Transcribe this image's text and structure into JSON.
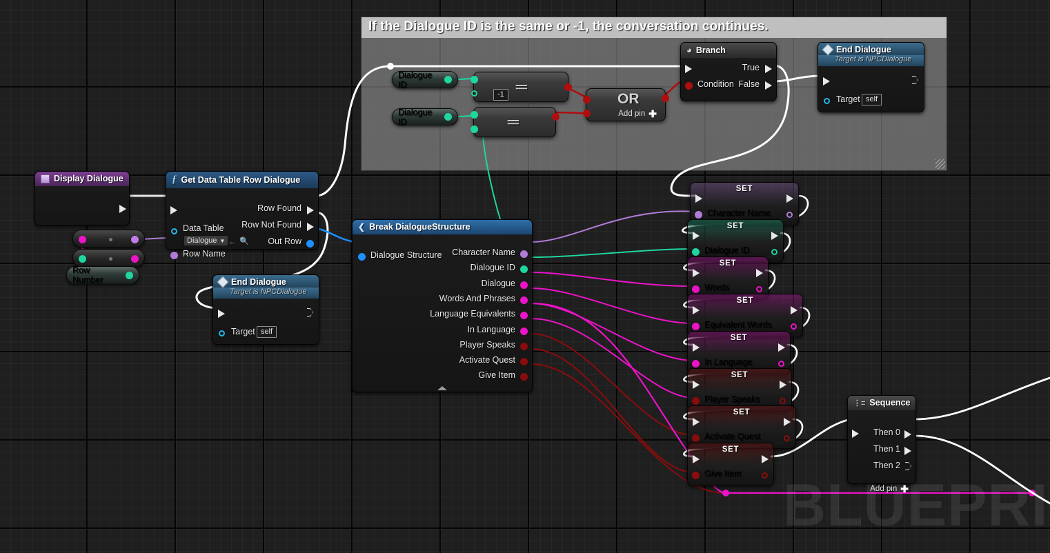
{
  "comment": {
    "text": "If the Dialogue ID is the same or -1, the conversation continues."
  },
  "watermark": {
    "text": "BLUEPRINT"
  },
  "colors": {
    "exec_white": "#e8e8e8",
    "struct_blue": "#1e90ff",
    "name_purple": "#c07ce8",
    "int_green": "#1fd6a0",
    "string_magenta": "#ec13c8",
    "bool_red": "#a10a0a",
    "object_cyan": "#25b6e8",
    "text_purple": "#b07cd8"
  },
  "nodes": {
    "display_dialogue": {
      "title": "Display Dialogue",
      "icon": "event-icon"
    },
    "get_data_table_row": {
      "title": "Get Data Table Row Dialogue",
      "icon": "function-icon",
      "in_exec": "",
      "inputs": [
        {
          "label": "Data Table",
          "value": "Dialogue"
        },
        {
          "label": "Row Name",
          "value": ""
        }
      ],
      "outputs": [
        {
          "label": "Row Found"
        },
        {
          "label": "Row Not Found"
        },
        {
          "label": "Out Row"
        }
      ]
    },
    "end_dialogue_left": {
      "title": "End Dialogue",
      "subtitle": "Target is NPCDialogue",
      "icon": "diamond-icon",
      "target_label": "Target",
      "target_value": "self"
    },
    "end_dialogue_right": {
      "title": "End Dialogue",
      "subtitle": "Target is NPCDialogue",
      "icon": "diamond-icon",
      "target_label": "Target",
      "target_value": "self"
    },
    "row_number": {
      "label": "Row Number"
    },
    "dialogue_id_get_1": {
      "label": "Dialogue ID"
    },
    "dialogue_id_get_2": {
      "label": "Dialogue ID"
    },
    "equals_1": {
      "symbol": "==",
      "literal": "-1"
    },
    "equals_2": {
      "symbol": "==",
      "literal": ""
    },
    "or_node": {
      "symbol": "OR",
      "add_pin": "Add pin"
    },
    "branch": {
      "title": "Branch",
      "icon": "branch-icon",
      "condition_label": "Condition",
      "true_label": "True",
      "false_label": "False"
    },
    "break_struct": {
      "title": "Break DialogueStructure",
      "icon": "break-icon",
      "input": "Dialogue Structure",
      "outputs": [
        {
          "label": "Character Name",
          "color": "#b07cd8"
        },
        {
          "label": "Dialogue ID",
          "color": "#1fd6a0"
        },
        {
          "label": "Dialogue",
          "color": "#ec13c8"
        },
        {
          "label": "Words And Phrases",
          "color": "#ec13c8"
        },
        {
          "label": "Language Equivalents",
          "color": "#ec13c8"
        },
        {
          "label": "In Language",
          "color": "#ec13c8"
        },
        {
          "label": "Player Speaks",
          "color": "#8b0c0c"
        },
        {
          "label": "Activate Quest",
          "color": "#8b0c0c"
        },
        {
          "label": "Give Item",
          "color": "#8b0c0c"
        }
      ]
    },
    "sequence": {
      "title": "Sequence",
      "icon": "sequence-icon",
      "outputs": [
        "Then 0",
        "Then 1",
        "Then 2"
      ],
      "add_pin": "Add pin"
    }
  },
  "set_nodes": [
    {
      "title": "SET",
      "label": "Character Name",
      "color": "#b07cd8",
      "tint": "rgba(176,124,216,0.30)"
    },
    {
      "title": "SET",
      "label": "Dialogue ID",
      "color": "#1fd6a0",
      "tint": "rgba(31,214,160,0.28)"
    },
    {
      "title": "SET",
      "label": "Words",
      "color": "#ec13c8",
      "tint": "rgba(236,19,200,0.30)"
    },
    {
      "title": "SET",
      "label": "Equivalent Words",
      "color": "#ec13c8",
      "tint": "rgba(236,19,200,0.30)"
    },
    {
      "title": "SET",
      "label": "In Language",
      "color": "#ec13c8",
      "tint": "rgba(236,19,200,0.30)"
    },
    {
      "title": "SET",
      "label": "Player Speaks",
      "color": "#8b0c0c",
      "tint": "rgba(160,20,20,0.30)"
    },
    {
      "title": "SET",
      "label": "Activate Quest",
      "color": "#8b0c0c",
      "tint": "rgba(160,20,20,0.30)"
    },
    {
      "title": "SET",
      "label": "Give Item",
      "color": "#8b0c0c",
      "tint": "rgba(160,20,20,0.30)"
    }
  ]
}
